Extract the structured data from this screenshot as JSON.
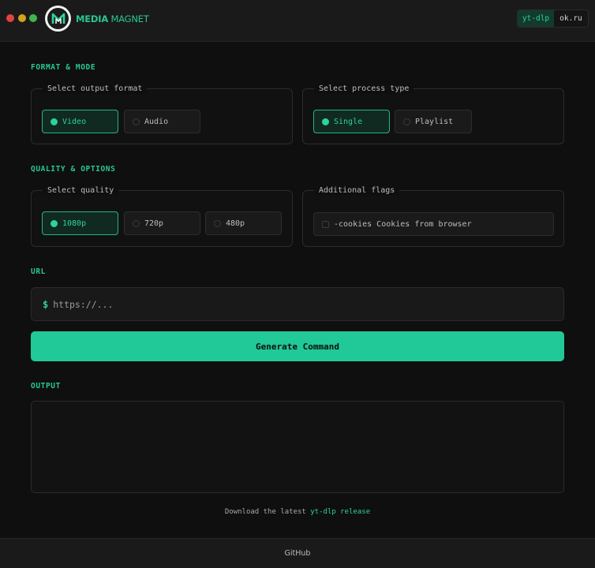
{
  "window": {
    "brand_primary": "MEDIA",
    "brand_secondary": "MAGNET",
    "logo_icon": "magnet-m-logo-icon",
    "switcher": [
      {
        "label": "yt-dlp",
        "active": true
      },
      {
        "label": "ok.ru",
        "active": false
      }
    ]
  },
  "colors": {
    "accent": "#20c997",
    "background": "#0f0f0f"
  },
  "format_mode": {
    "section_label": "FORMAT & MODE",
    "output_format": {
      "legend": "Select output format",
      "options": [
        {
          "label": "Video",
          "selected": true
        },
        {
          "label": "Audio",
          "selected": false
        }
      ]
    },
    "process_type": {
      "legend": "Select process type",
      "options": [
        {
          "label": "Single",
          "selected": true
        },
        {
          "label": "Playlist",
          "selected": false
        }
      ]
    }
  },
  "quality_options": {
    "section_label": "QUALITY & OPTIONS",
    "quality": {
      "legend": "Select quality",
      "options": [
        {
          "label": "1080p",
          "selected": true
        },
        {
          "label": "720p",
          "selected": false
        },
        {
          "label": "480p",
          "selected": false
        }
      ]
    },
    "flags": {
      "legend": "Additional flags",
      "cookies_label": "-cookies Cookies from browser",
      "cookies_checked": false
    }
  },
  "url": {
    "section_label": "URL",
    "prompt": "$",
    "placeholder": "https://..."
  },
  "generate_button": "Generate Command",
  "output": {
    "section_label": "OUTPUT",
    "value": ""
  },
  "download": {
    "prefix": "Download the latest",
    "link": "yt-dlp release"
  },
  "footer": {
    "link": "GitHub"
  }
}
